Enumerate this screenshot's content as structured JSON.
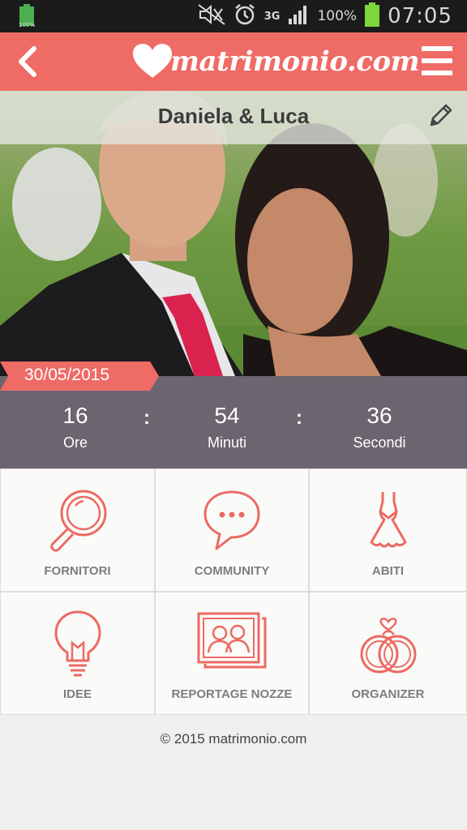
{
  "status_bar": {
    "battery_small": "100%",
    "network": "3G",
    "battery_percent": "100%",
    "time": "07:05"
  },
  "navbar": {
    "logo_text": "matrimonio.com"
  },
  "hero": {
    "couple_name": "Daniela & Luca",
    "wedding_date": "30/05/2015"
  },
  "countdown": {
    "hours": "16",
    "hours_label": "Ore",
    "minutes": "54",
    "minutes_label": "Minuti",
    "seconds": "36",
    "seconds_label": "Secondi",
    "separator": ":"
  },
  "menu": [
    {
      "label": "FORNITORI",
      "icon": "magnifier-icon"
    },
    {
      "label": "COMMUNITY",
      "icon": "chat-bubble-icon"
    },
    {
      "label": "ABITI",
      "icon": "dress-icon"
    },
    {
      "label": "IDEE",
      "icon": "lightbulb-icon"
    },
    {
      "label": "REPORTAGE NOZZE",
      "icon": "photo-album-icon"
    },
    {
      "label": "ORGANIZER",
      "icon": "rings-icon"
    }
  ],
  "footer": {
    "copyright": "© 2015 matrimonio.com"
  },
  "colors": {
    "brand": "#ef6b66",
    "countdown_bg": "#6c6570",
    "icon_stroke": "#ec6a63"
  }
}
